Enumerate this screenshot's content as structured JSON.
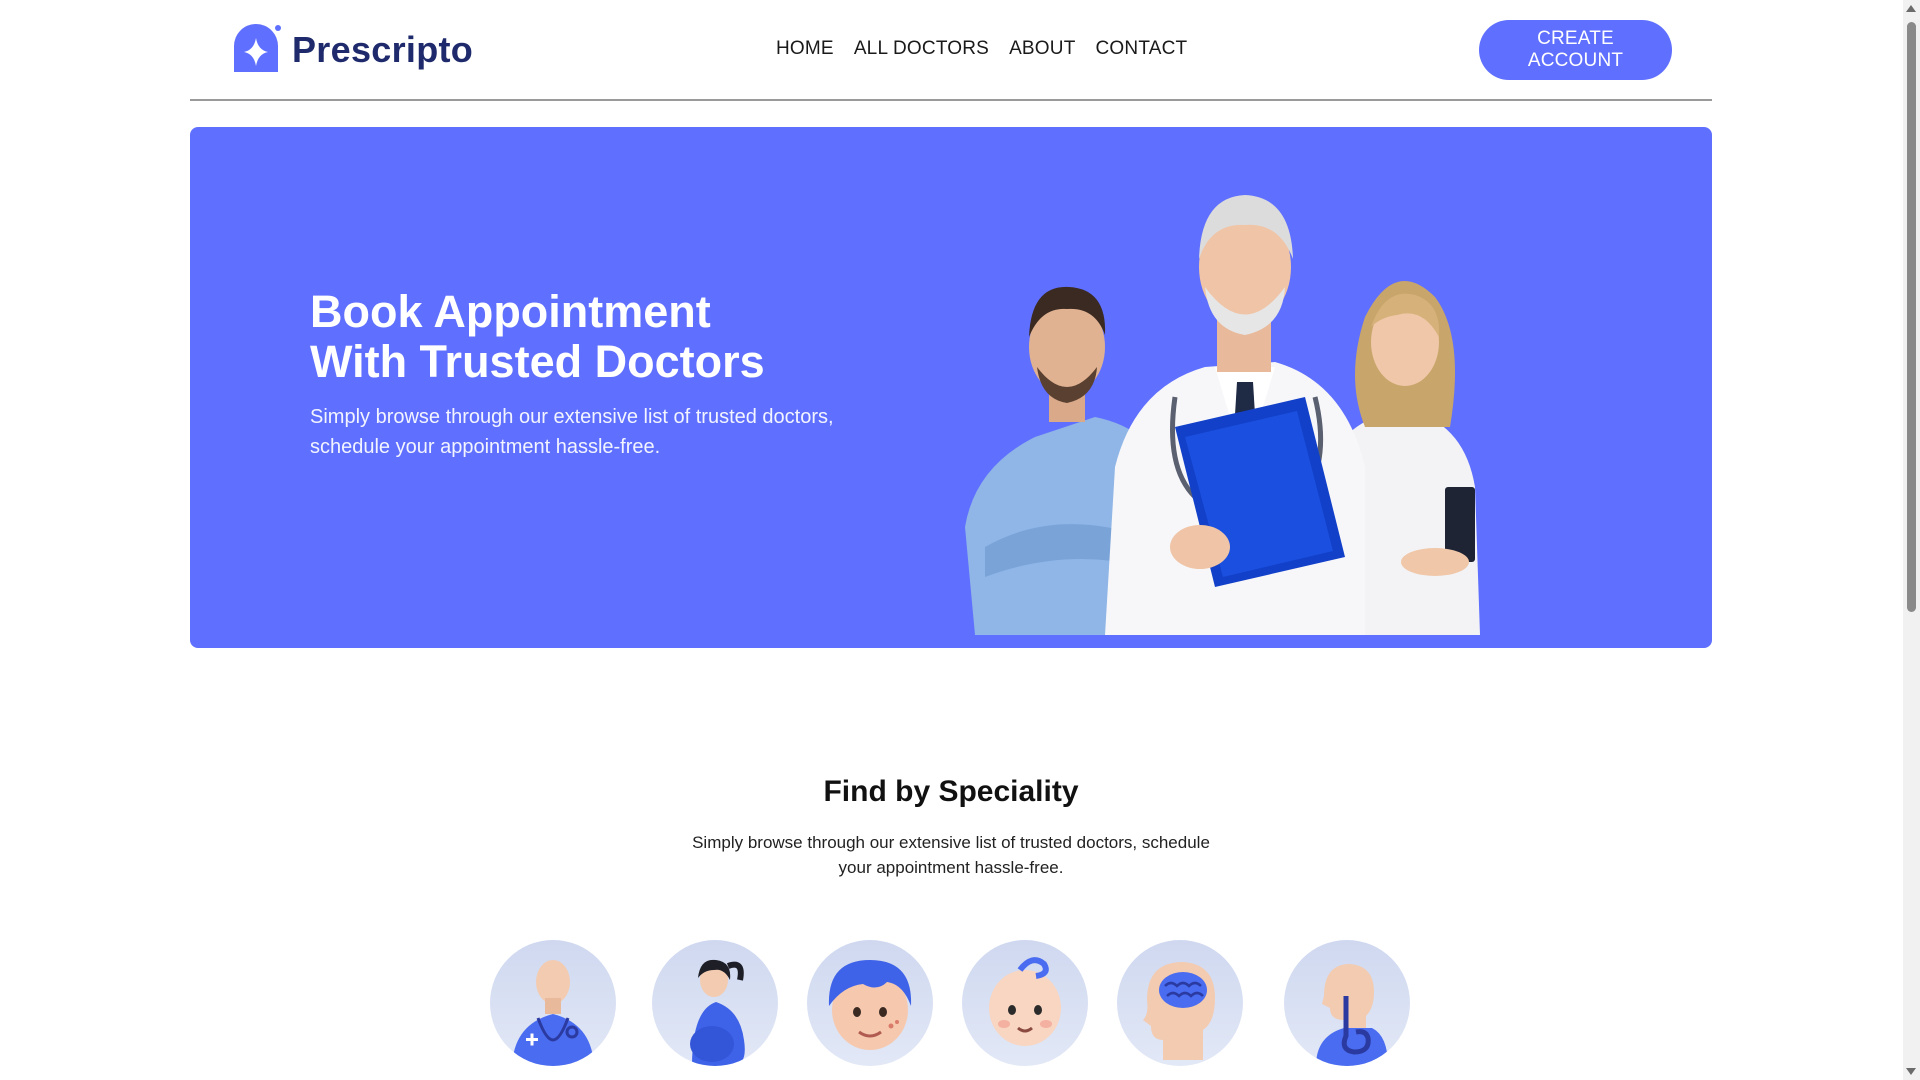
{
  "brand": {
    "name": "Prescripto",
    "color": "#5f6fff",
    "logo_icon": "sparkle-pin-icon"
  },
  "nav": {
    "links": [
      {
        "label": "HOME"
      },
      {
        "label": "ALL DOCTORS"
      },
      {
        "label": "ABOUT"
      },
      {
        "label": "CONTACT"
      }
    ],
    "cta_label": "CREATE ACCOUNT"
  },
  "hero": {
    "title_line1": "Book Appointment",
    "title_line2": "With Trusted Doctors",
    "subtitle_line1": "Simply browse through our extensive list of trusted doctors,",
    "subtitle_line2": "schedule your appointment hassle-free.",
    "background": "#5f6fff",
    "image": "group-of-doctors-illustration"
  },
  "speciality": {
    "title": "Find by Speciality",
    "subtitle": "Simply browse through our extensive list of trusted doctors, schedule your appointment hassle-free.",
    "items": [
      {
        "icon": "general-physician-icon"
      },
      {
        "icon": "gynecologist-icon"
      },
      {
        "icon": "dermatologist-icon"
      },
      {
        "icon": "pediatrician-icon"
      },
      {
        "icon": "neurologist-icon"
      },
      {
        "icon": "gastroenterologist-icon"
      }
    ]
  }
}
